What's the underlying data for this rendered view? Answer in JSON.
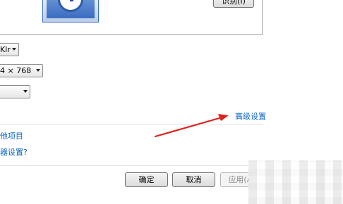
{
  "monitor_area": {
    "identify_button_label": "识别(I)"
  },
  "settings": {
    "display_select_value": "Klr",
    "resolution_select_value": "4 × 768",
    "orientation_select_value": ""
  },
  "links": {
    "advanced_settings": "高级设置",
    "other_items": "他项目",
    "which_settings": "器设置?"
  },
  "buttons": {
    "ok_label": "确定",
    "cancel_label": "取消",
    "apply_label": "应用(A)"
  },
  "colors": {
    "link_blue": "#0a63c9",
    "arrow_red": "#e0201c",
    "monitor_blue": "#2c5ca8"
  },
  "icons": {
    "monitor": "monitor-icon",
    "dropdown": "chevron-down-icon",
    "annotation": "red-arrow-icon"
  }
}
